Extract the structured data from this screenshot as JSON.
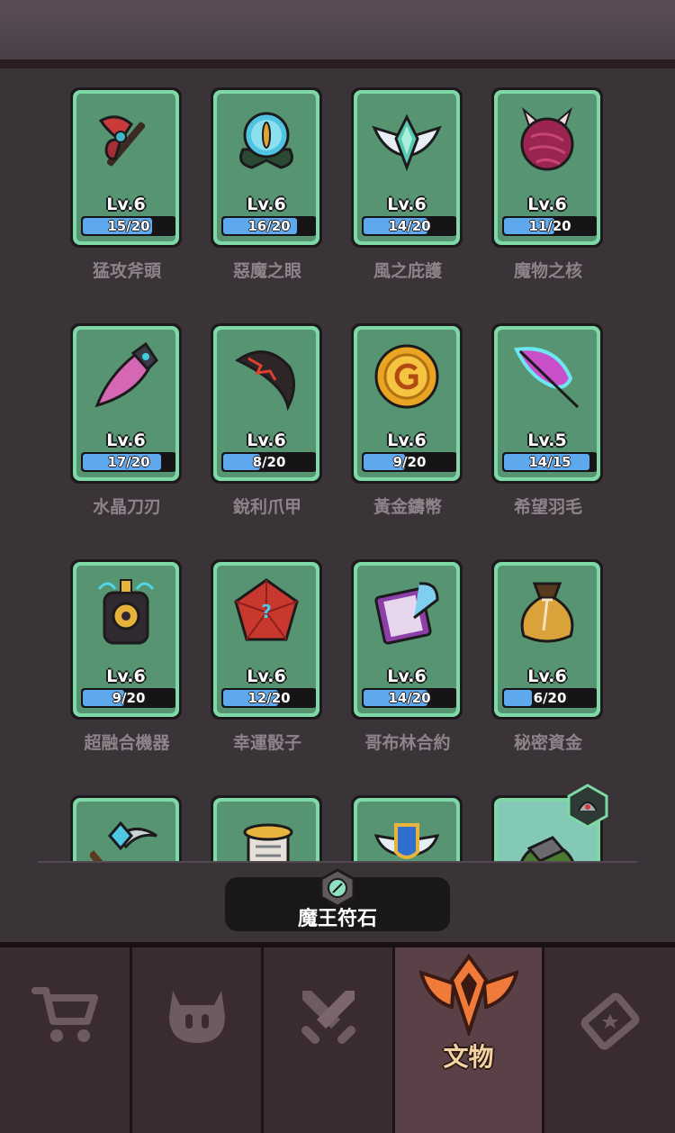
{
  "relics": [
    {
      "name": "猛攻斧頭",
      "level": "Lv.6",
      "progress": "15/20",
      "fraction": 0.75,
      "icon": "axe-icon"
    },
    {
      "name": "惡魔之眼",
      "level": "Lv.6",
      "progress": "16/20",
      "fraction": 0.8,
      "icon": "demon-eye-icon"
    },
    {
      "name": "風之庇護",
      "level": "Lv.6",
      "progress": "14/20",
      "fraction": 0.7,
      "icon": "wind-wings-icon"
    },
    {
      "name": "魔物之核",
      "level": "Lv.6",
      "progress": "11/20",
      "fraction": 0.55,
      "icon": "monster-core-icon"
    },
    {
      "name": "水晶刀刃",
      "level": "Lv.6",
      "progress": "17/20",
      "fraction": 0.85,
      "icon": "crystal-blade-icon"
    },
    {
      "name": "銳利爪甲",
      "level": "Lv.6",
      "progress": "8/20",
      "fraction": 0.4,
      "icon": "claw-icon"
    },
    {
      "name": "黃金鑄幣",
      "level": "Lv.6",
      "progress": "9/20",
      "fraction": 0.45,
      "icon": "gold-coin-icon"
    },
    {
      "name": "希望羽毛",
      "level": "Lv.5",
      "progress": "14/15",
      "fraction": 0.93,
      "icon": "feather-icon"
    },
    {
      "name": "超融合機器",
      "level": "Lv.6",
      "progress": "9/20",
      "fraction": 0.45,
      "icon": "fusion-machine-icon"
    },
    {
      "name": "幸運骰子",
      "level": "Lv.6",
      "progress": "12/20",
      "fraction": 0.6,
      "icon": "lucky-dice-icon"
    },
    {
      "name": "哥布林合約",
      "level": "Lv.6",
      "progress": "14/20",
      "fraction": 0.7,
      "icon": "goblin-contract-icon"
    },
    {
      "name": "秘密資金",
      "level": "Lv.6",
      "progress": "6/20",
      "fraction": 0.3,
      "icon": "money-bag-icon"
    }
  ],
  "partial_row_icons": [
    "pickaxe-icon",
    "scroll-icon",
    "shield-wings-icon",
    "turtle-shell-icon"
  ],
  "rune": {
    "label": "魔王符石",
    "icon": "rune-stone-icon"
  },
  "nav": {
    "tabs": [
      {
        "icon": "cart-icon",
        "label": ""
      },
      {
        "icon": "demon-head-icon",
        "label": ""
      },
      {
        "icon": "crossed-swords-icon",
        "label": ""
      },
      {
        "icon": "winged-badge-icon",
        "label": "文物",
        "active": true
      },
      {
        "icon": "ticket-icon",
        "label": ""
      }
    ]
  },
  "colors": {
    "bar_fill": "#5ea9ee",
    "card_border": "#7fd9a6",
    "card_face": "#569472",
    "active_tab": "#5a4148"
  }
}
